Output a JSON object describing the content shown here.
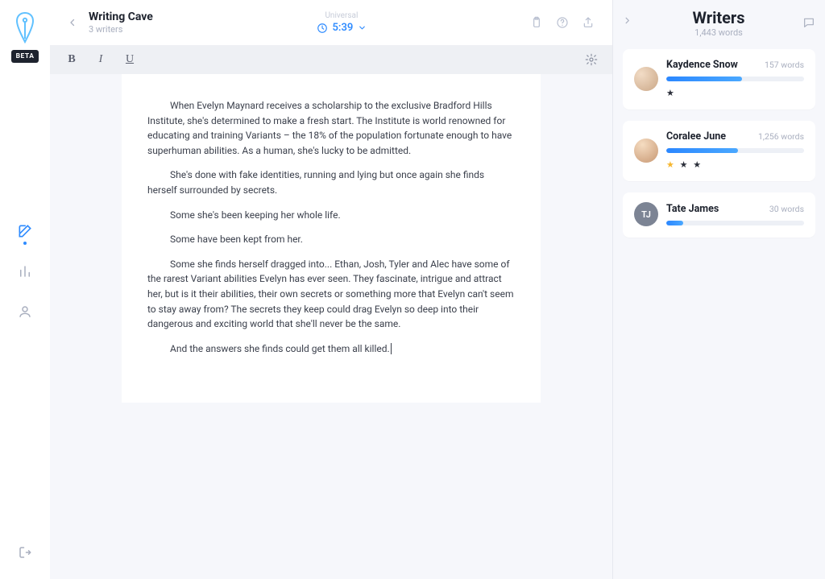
{
  "brand": {
    "beta_label": "BETA"
  },
  "header": {
    "title": "Writing Cave",
    "subtitle": "3 writers",
    "mode_label": "Universal",
    "timer": "5:39"
  },
  "document": {
    "paragraphs": [
      "When Evelyn Maynard receives a scholarship to the exclusive Bradford Hills Institute, she's determined to make a fresh start. The Institute is world renowned for educating and training Variants – the 18% of the population fortunate enough to have superhuman abilities. As a human, she's lucky to be admitted.",
      "She's done with fake identities, running and lying but once again she finds herself surrounded by secrets.",
      "Some she's been keeping her whole life.",
      "Some have been kept from her.",
      "Some she finds herself dragged into... Ethan, Josh, Tyler and Alec have some of the rarest Variant abilities Evelyn has ever seen. They fascinate, intrigue and attract her, but is it their abilities, their own secrets or something more that Evelyn can't seem to stay away from? The secrets they keep could drag Evelyn so deep into their dangerous and exciting world that she'll never be the same.",
      "And the answers she finds could get them all killed."
    ]
  },
  "right": {
    "title": "Writers",
    "subtitle": "1,443 words",
    "writers": [
      {
        "name": "Kaydence Snow",
        "words_label": "157 words",
        "progress_pct": 55,
        "stars_gold": 0,
        "stars_plain": 1,
        "initials": ""
      },
      {
        "name": "Coralee June",
        "words_label": "1,256 words",
        "progress_pct": 52,
        "stars_gold": 1,
        "stars_plain": 2,
        "initials": ""
      },
      {
        "name": "Tate James",
        "words_label": "30 words",
        "progress_pct": 12,
        "stars_gold": 0,
        "stars_plain": 0,
        "initials": "TJ"
      }
    ]
  }
}
